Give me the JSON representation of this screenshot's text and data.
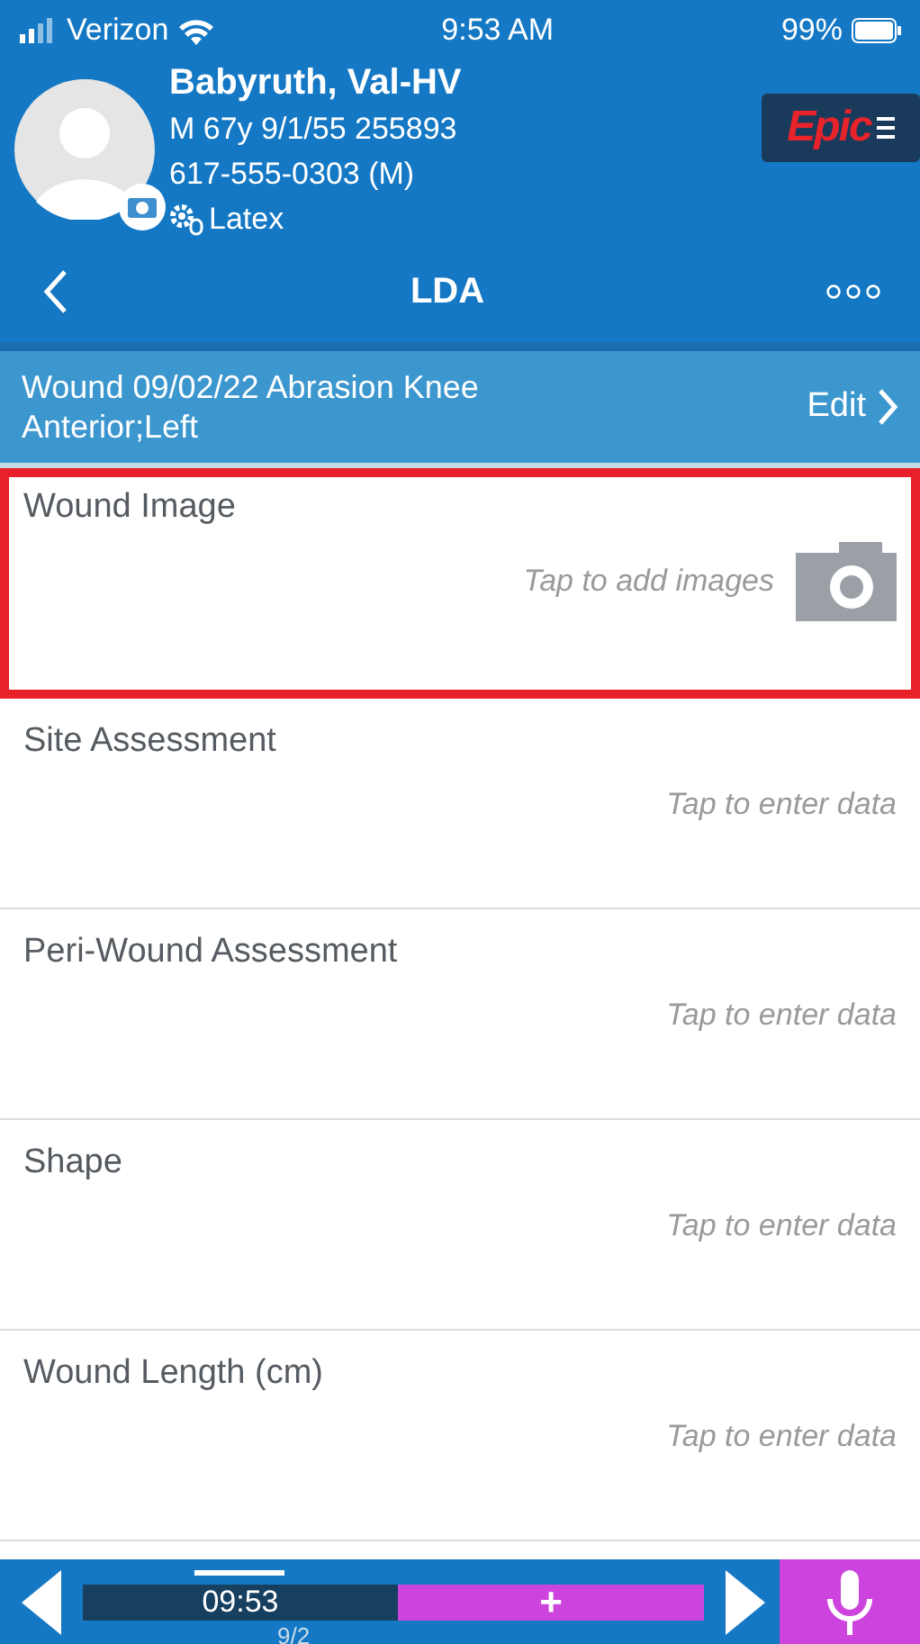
{
  "status_bar": {
    "carrier": "Verizon",
    "time": "9:53 AM",
    "battery": "99%"
  },
  "patient": {
    "name": "Babyruth, Val-HV",
    "demographics": "M 67y 9/1/55 255893",
    "phone": "617-555-0303 (M)",
    "allergy": "Latex"
  },
  "logo": {
    "text": "Epic"
  },
  "nav": {
    "title": "LDA"
  },
  "banner": {
    "line1": "Wound 09/02/22 Abrasion  Knee",
    "line2": "Anterior;Left",
    "action": "Edit"
  },
  "fields": [
    {
      "kind": "image",
      "label": "Wound Image",
      "hint": "Tap to add images",
      "highlighted": true
    },
    {
      "kind": "data",
      "label": "Site Assessment",
      "hint": "Tap to enter data",
      "highlighted": false
    },
    {
      "kind": "data",
      "label": "Peri-Wound Assessment",
      "hint": "Tap to enter data",
      "highlighted": false
    },
    {
      "kind": "data",
      "label": "Shape",
      "hint": "Tap to enter data",
      "highlighted": false
    },
    {
      "kind": "data",
      "label": "Wound Length (cm)",
      "hint": "Tap to enter data",
      "highlighted": false
    }
  ],
  "timeline": {
    "time": "09:53",
    "date": "9/2",
    "add": "+"
  }
}
